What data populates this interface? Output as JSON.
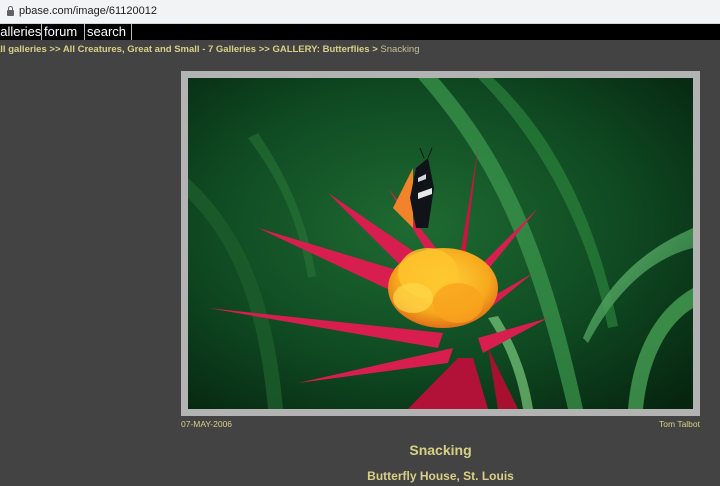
{
  "browser": {
    "url": "pbase.com/image/61120012"
  },
  "nav": {
    "galleries": "galleries",
    "forum": "forum",
    "search": "search"
  },
  "breadcrumb": {
    "root": "all galleries",
    "sep1": ">>",
    "level1": "All Creatures, Great and Small - 7 Galleries",
    "sep2": ">>",
    "level2": "GALLERY: Butterflies",
    "sep3": ">",
    "current": "Snacking"
  },
  "photo": {
    "date": "07-MAY-2006",
    "author": "Tom Talbot",
    "title": "Snacking",
    "caption": "Butterfly House, St. Louis"
  },
  "colors": {
    "page_bg": "#434343",
    "link": "#d9cf87",
    "frame": "#b3b3b3"
  }
}
